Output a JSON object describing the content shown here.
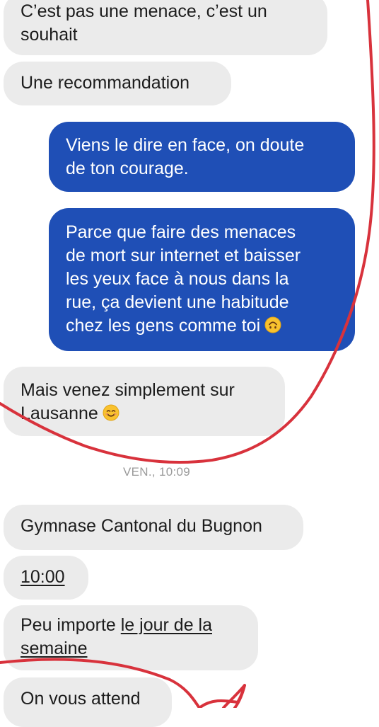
{
  "messages": [
    {
      "lines": [
        "C’est pas une menace, c’est un",
        "souhait"
      ]
    },
    {
      "lines": [
        "Une recommandation"
      ]
    },
    {
      "lines": [
        "Viens le dire en face, on doute",
        "de ton courage."
      ]
    },
    {
      "lines": [
        "Parce que faire des menaces",
        "de mort sur internet et baisser",
        "les yeux face à nous dans la",
        "rue, ça devient une habitude",
        "chez les gens comme toi"
      ]
    },
    {
      "lines": [
        "Mais venez simplement sur",
        "Lausanne"
      ]
    },
    {
      "lines": [
        "Gymnase Cantonal du Bugnon"
      ]
    },
    {
      "lines": [
        "10:00"
      ]
    },
    {
      "line1_prefix": "Peu importe ",
      "line1_link": "le jour de la",
      "line2_link": "semaine"
    },
    {
      "lines": [
        "On vous attend"
      ]
    }
  ],
  "timestamp": "VEN., 10:09",
  "icons": {
    "upside_down_emoji": "upside-down-face-icon",
    "smiling_emoji": "smiling-face-icon"
  },
  "colors": {
    "outgoing_bubble": "#1f4fb6",
    "incoming_bubble": "#ebebeb",
    "annotation_red": "#d8323c"
  }
}
